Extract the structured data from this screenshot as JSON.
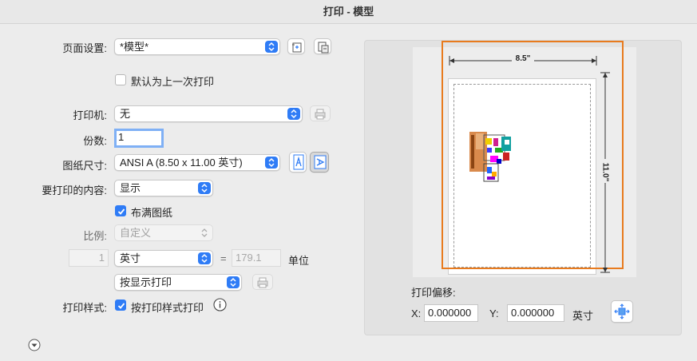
{
  "window": {
    "title": "打印 - 模型"
  },
  "page_setup": {
    "label": "页面设置:",
    "value": "*模型*"
  },
  "default_last_print": {
    "label": "默认为上一次打印",
    "checked": false
  },
  "printer": {
    "label": "打印机:",
    "value": "无"
  },
  "copies": {
    "label": "份数:",
    "value": "1"
  },
  "paper_size": {
    "label": "图纸尺寸:",
    "value": "ANSI A (8.50 x 11.00 英寸)"
  },
  "plot_area": {
    "label": "要打印的内容:",
    "value": "显示"
  },
  "fit_to_paper": {
    "label": "布满图纸",
    "checked": true
  },
  "scale": {
    "label": "比例:",
    "value": "自定义",
    "left_value": "1",
    "unit_value": "英寸",
    "equals": "=",
    "right_value": "179.1",
    "unit_label": "单位"
  },
  "print_mode": {
    "value": "按显示打印"
  },
  "plot_style": {
    "label": "打印样式:",
    "checkbox_label": "按打印样式打印",
    "checked": true
  },
  "preview": {
    "width_label": "8.5\"",
    "height_label": "11.0\""
  },
  "offset": {
    "label": "打印偏移:",
    "x_label": "X:",
    "x_value": "0.000000",
    "y_label": "Y:",
    "y_value": "0.000000",
    "unit": "英寸"
  },
  "colors": {
    "accent": "#2f7cf6",
    "highlight_box": "#e87b1e"
  },
  "icons": [
    "chevron-updown-icon",
    "add-page-setup-icon",
    "import-page-setup-icon",
    "printer-properties-icon",
    "portrait-icon",
    "landscape-icon",
    "printer-preview-icon",
    "info-icon",
    "center-plot-icon",
    "disclosure-icon"
  ]
}
